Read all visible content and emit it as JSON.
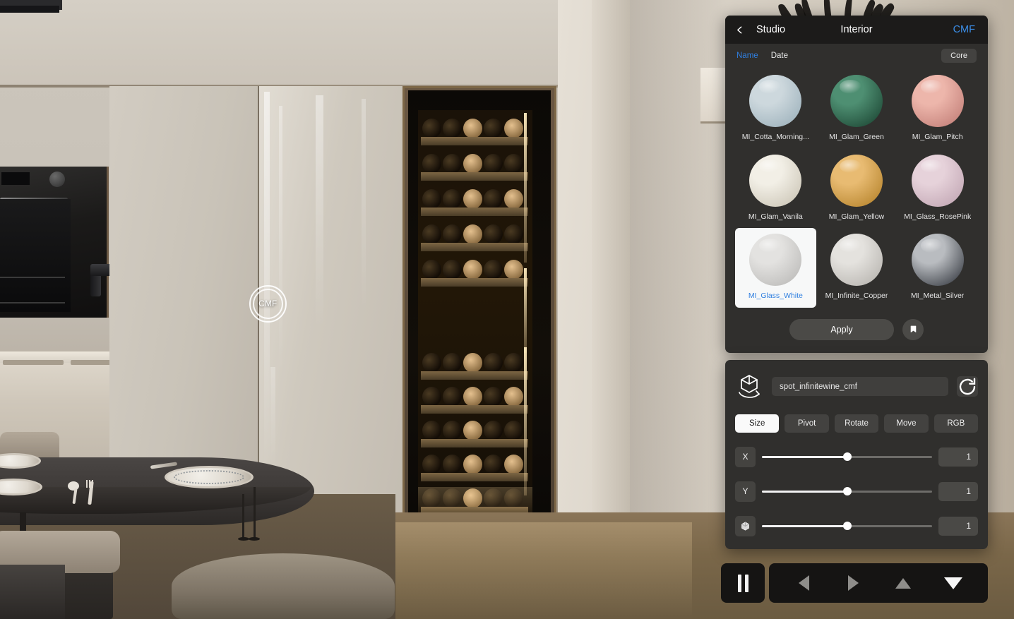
{
  "scene": {
    "hotspot_label": "CMF"
  },
  "material_panel": {
    "header": {
      "back_icon": "chevron-left-icon",
      "studio_label": "Studio",
      "interior_label": "Interior",
      "cmf_label": "CMF",
      "cmf_color": "#3b8ee8"
    },
    "sort": {
      "name_label": "Name",
      "date_label": "Date",
      "active": "Name",
      "active_color": "#2f7fe0"
    },
    "filter_chip": "Core",
    "materials": [
      {
        "label": "MI_Cotta_Morning...",
        "color": "#cdd8dd",
        "color2": "#9fb3bd",
        "selected": false
      },
      {
        "label": "MI_Glam_Green",
        "color": "#4e8f72",
        "color2": "#1f4a37",
        "selected": false
      },
      {
        "label": "MI_Glam_Pitch",
        "color": "#edb6ab",
        "color2": "#c4817a",
        "selected": false
      },
      {
        "label": "MI_Glam_Vanila",
        "color": "#f2efe6",
        "color2": "#cdc7b8",
        "selected": false
      },
      {
        "label": "MI_Glam_Yellow",
        "color": "#e8bb72",
        "color2": "#b8862f",
        "selected": false
      },
      {
        "label": "MI_Glass_RosePink",
        "color": "#e6d2da",
        "color2": "#c3a8b5",
        "selected": false
      },
      {
        "label": "MI_Glass_White",
        "color": "#e3e2e0",
        "color2": "#bdbcba",
        "selected": true
      },
      {
        "label": "MI_Infinite_Copper",
        "color": "#e4e2de",
        "color2": "#b9b6b1",
        "selected": false
      },
      {
        "label": "MI_Metal_Silver",
        "color": "#b9bcc0",
        "color2": "#3f434a",
        "selected": false
      }
    ],
    "apply_label": "Apply",
    "tag_icon": "tag-icon"
  },
  "transform_panel": {
    "object_icon": "cube-rotate-icon",
    "object_name": "spot_infinitewine_cmf",
    "reset_icon": "refresh-icon",
    "tabs": [
      {
        "label": "Size",
        "active": true
      },
      {
        "label": "Pivot",
        "active": false
      },
      {
        "label": "Rotate",
        "active": false
      },
      {
        "label": "Move",
        "active": false
      },
      {
        "label": "RGB",
        "active": false
      }
    ],
    "sliders": [
      {
        "axis": "X",
        "icon": null,
        "value": "1",
        "percent": 50
      },
      {
        "axis": "Y",
        "icon": null,
        "value": "1",
        "percent": 50
      },
      {
        "axis": "",
        "icon": "cube-solid-icon",
        "value": "1",
        "percent": 50
      }
    ]
  },
  "playback": {
    "pause_icon": "pause-icon",
    "nav": [
      {
        "icon": "triangle-left-icon",
        "state": "dim"
      },
      {
        "icon": "triangle-right-icon",
        "state": "dim"
      },
      {
        "icon": "triangle-up-icon",
        "state": "dim"
      },
      {
        "icon": "triangle-down-icon",
        "state": "bright"
      }
    ]
  }
}
